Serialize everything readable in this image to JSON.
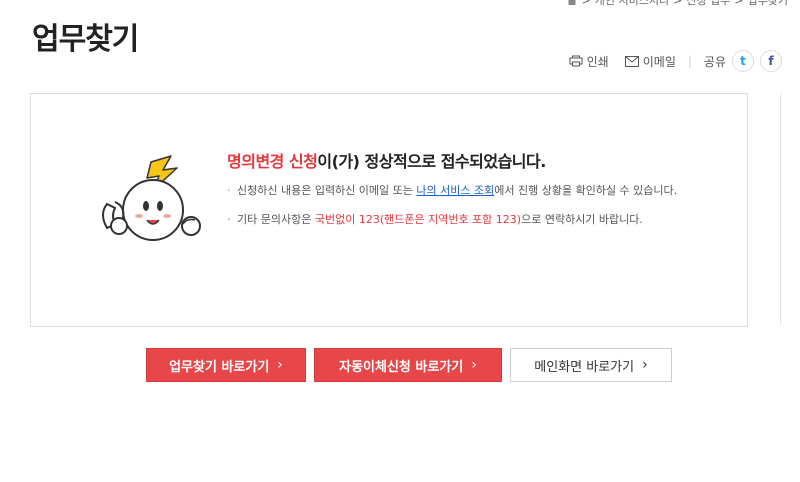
{
  "breadcrumb": {
    "items": [
      "개인 서비스처리",
      "신청 업무",
      "업무찾기"
    ],
    "separator": ">"
  },
  "page": {
    "title": "업무찾기"
  },
  "utility": {
    "print_label": "인쇄",
    "email_label": "이메일",
    "share_label": "공유",
    "twitter_glyph": "t",
    "facebook_glyph": "f"
  },
  "message": {
    "title_highlight": "명의변경 신청",
    "title_rest": "이(가) 정상적으로 접수되었습니다.",
    "notice1_prefix": "신청하신 내용은 입력하신 이메일 또는 ",
    "notice1_link": "나의 서비스 조회",
    "notice1_suffix": "에서 진행 상황을 확인하실 수 있습니다.",
    "notice2_prefix": "기타 문의사항은 ",
    "notice2_highlight": "국번없이 123(핸드폰은 지역번호 포함 123)",
    "notice2_suffix": "으로 연락하시기 바랍니다."
  },
  "buttons": {
    "task_search": "업무찾기 바로가기",
    "auto_transfer": "자동이체신청 바로가기",
    "main": "메인화면 바로가기",
    "chevron": "›"
  },
  "colors": {
    "accent_red": "#e8474a",
    "link_blue": "#1f5fbf"
  }
}
